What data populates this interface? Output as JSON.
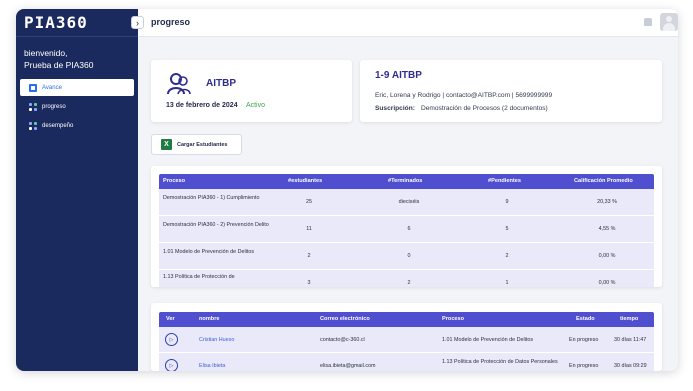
{
  "app": {
    "logo": "PIA360"
  },
  "sidebar": {
    "welcome_line1": "bienvenido,",
    "welcome_line2": "Prueba de PIA360",
    "items": [
      {
        "label": "Avance",
        "icon": "chart-icon",
        "active": true
      },
      {
        "label": "progreso",
        "icon": "grid-icon",
        "active": false
      },
      {
        "label": "desempeño",
        "icon": "grid-icon",
        "active": false
      }
    ],
    "collapse_glyph": "›"
  },
  "header": {
    "title": "progreso"
  },
  "org": {
    "name": "AITBP",
    "date": "13 de febrero de 2024",
    "separator": "·",
    "status": "Activo"
  },
  "info": {
    "title": "1-9  AITBP",
    "contacts": "Eric, Lorena y Rodrigo | contacto@AITBP.com | 5699999999",
    "subscription_label": "Suscripción:",
    "subscription_value": "Demostración de Procesos (2 documentos)"
  },
  "upload": {
    "label": "Cargar Estudiantes",
    "icon": "excel-icon",
    "icon_glyph": "X"
  },
  "process_table": {
    "headers": [
      "Proceso",
      "#estudiantes",
      "#Terminados",
      "#Pendientes",
      "Calificación Promedio"
    ],
    "rows": [
      [
        "Demostración PIA360 - 1) Cumplimiento",
        "25",
        "dieciséis",
        "9",
        "20,33 %"
      ],
      [
        "Demostración PIA360 - 2) Prevención Delito",
        "11",
        "6",
        "5",
        "4,55 %"
      ],
      [
        "1.01 Modelo de Prevención de Delitos",
        "2",
        "0",
        "2",
        "0,00 %"
      ],
      [
        "1.13 Política de Protección de",
        "3",
        "2",
        "1",
        "0,00 %"
      ]
    ]
  },
  "students_table": {
    "headers": [
      "Ver",
      "nombre",
      "Correo electrónico",
      "Proceso",
      "Estado",
      "tiempo"
    ],
    "rows": [
      [
        "Cristian Hueso",
        "contacto@c-360.cl",
        "1.01 Modelo de Prevención de Delitos",
        "En progreso",
        "30 días 11:47"
      ],
      [
        "Elisa Ibieta",
        "elisa.ibieta@gmail.com",
        "1.13 Política de Protección de Datos Personales",
        "En progreso",
        "30 días 09:29"
      ]
    ],
    "view_glyph": "▷"
  },
  "colors": {
    "sidebar_bg": "#1b2a5e",
    "accent": "#4f4fcf",
    "title_purple": "#2f2e8f",
    "status_green": "#3fa34d",
    "row_bg": "#e9e9fa"
  }
}
